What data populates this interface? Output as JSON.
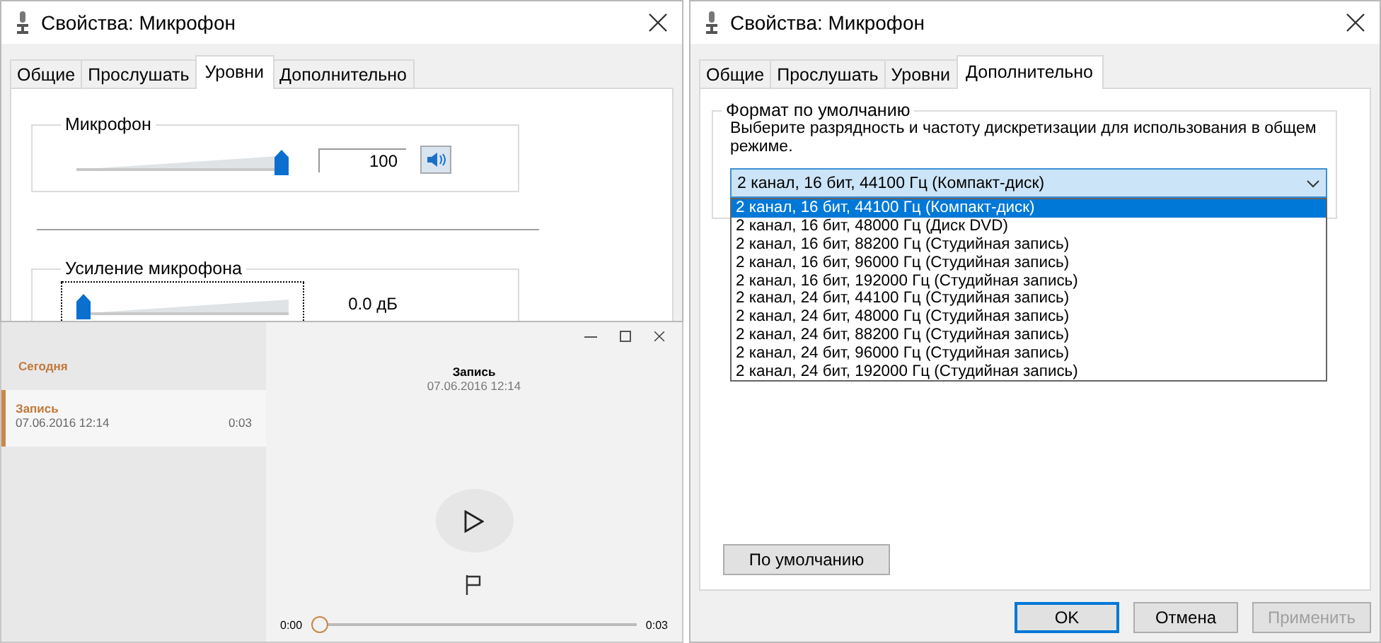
{
  "left_dialog": {
    "title": "Свойства: Микрофон",
    "tabs": [
      {
        "label": "Общие",
        "selected": false
      },
      {
        "label": "Прослушать",
        "selected": false
      },
      {
        "label": "Уровни",
        "selected": true
      },
      {
        "label": "Дополнительно",
        "selected": false
      }
    ],
    "groups": [
      {
        "kind": "volume",
        "label": "Микрофон",
        "level": 1,
        "value": "100",
        "focused": false
      },
      {
        "kind": "boost",
        "label": "Усиление микрофона",
        "level": 0,
        "value": "0.0 дБ",
        "focused": true
      }
    ]
  },
  "recorder": {
    "section": "Сегодня",
    "recordings": [
      {
        "name": "Запись",
        "date": "07.06.2016 12:14",
        "duration": "0:03",
        "selected": true
      }
    ],
    "title": "Запись",
    "date": "07.06.2016 12:14",
    "position": "0:00",
    "length": "0:03",
    "level": 0
  },
  "right_dialog": {
    "title": "Свойства: Микрофон",
    "tabs": [
      {
        "label": "Общие",
        "selected": false
      },
      {
        "label": "Прослушать",
        "selected": false
      },
      {
        "label": "Уровни",
        "selected": false
      },
      {
        "label": "Дополнительно",
        "selected": true
      }
    ],
    "format_group": {
      "label": "Формат по умолчанию",
      "description": "Выберите разрядность и частоту дискретизации для использования в общем режиме.",
      "value": "2 канал, 16 бит, 44100 Гц (Компакт-диск)",
      "options": [
        {
          "label": "2 канал, 16 бит, 44100 Гц (Компакт-диск)",
          "selected": true
        },
        {
          "label": "2 канал, 16 бит, 48000 Гц (Диск DVD)",
          "selected": false
        },
        {
          "label": "2 канал, 16 бит, 88200 Гц (Студийная запись)",
          "selected": false
        },
        {
          "label": "2 канал, 16 бит, 96000 Гц (Студийная запись)",
          "selected": false
        },
        {
          "label": "2 канал, 16 бит, 192000 Гц (Студийная запись)",
          "selected": false
        },
        {
          "label": "2 канал, 24 бит, 44100 Гц (Студийная запись)",
          "selected": false
        },
        {
          "label": "2 канал, 24 бит, 48000 Гц (Студийная запись)",
          "selected": false
        },
        {
          "label": "2 канал, 24 бит, 88200 Гц (Студийная запись)",
          "selected": false
        },
        {
          "label": "2 канал, 24 бит, 96000 Гц (Студийная запись)",
          "selected": false
        },
        {
          "label": "2 канал, 24 бит, 192000 Гц (Студийная запись)",
          "selected": false
        }
      ]
    },
    "default_button": "По умолчанию",
    "buttons": [
      {
        "label": "OK",
        "disabled": false,
        "default": true
      },
      {
        "label": "Отмена",
        "disabled": false,
        "default": false
      },
      {
        "label": "Применить",
        "disabled": true,
        "default": false
      }
    ]
  }
}
